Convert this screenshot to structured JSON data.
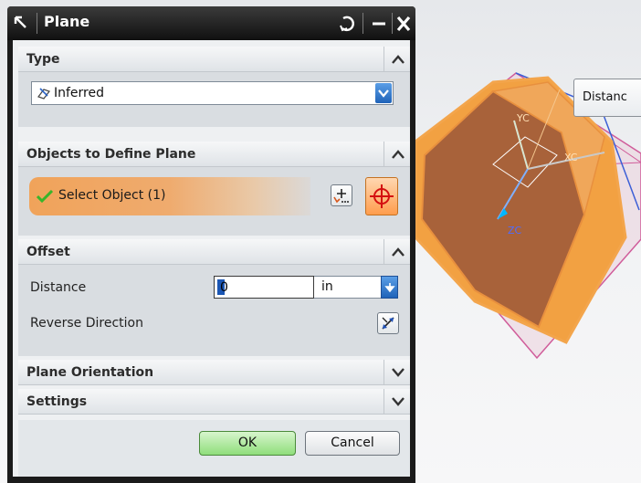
{
  "dialog": {
    "title": "Plane",
    "sections": {
      "type": {
        "title": "Type",
        "selected": "Inferred",
        "icon": "inferred-plane-icon"
      },
      "objects": {
        "title": "Objects to Define Plane",
        "select_label": "Select Object (1)"
      },
      "offset": {
        "title": "Offset",
        "distance_label": "Distance",
        "distance_value": "0",
        "unit": "in",
        "reverse_label": "Reverse Direction"
      },
      "orientation": {
        "title": "Plane Orientation"
      },
      "settings": {
        "title": "Settings"
      }
    },
    "buttons": {
      "ok": "OK",
      "cancel": "Cancel"
    }
  },
  "viewport": {
    "distance_tag": "Distanc",
    "axis_labels": {
      "yc": "YC",
      "xc": "XC",
      "zc": "ZC"
    }
  },
  "colors": {
    "part_face": "#a8623a",
    "part_edge": "#f3a54c",
    "plane_outline": "#d05c9a",
    "selection_gradient": "#f0a35a",
    "ok_button": "#8fde7b"
  }
}
